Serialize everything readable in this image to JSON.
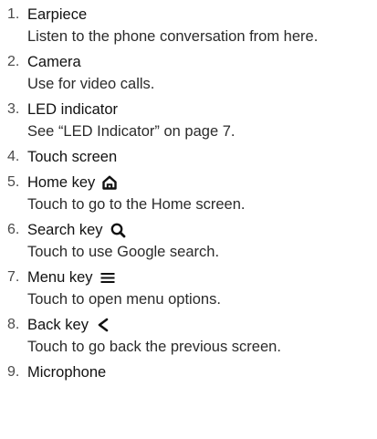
{
  "items": [
    {
      "num": "1.",
      "title": "Earpiece",
      "desc": "Listen to the phone conversation from here."
    },
    {
      "num": "2.",
      "title": "Camera",
      "desc": "Use for video calls."
    },
    {
      "num": "3.",
      "title": "LED indicator",
      "desc": "See “LED Indicator” on page 7."
    },
    {
      "num": "4.",
      "title": "Touch screen"
    },
    {
      "num": "5.",
      "title": "Home key",
      "icon": "home-icon",
      "desc": "Touch to go to the Home screen."
    },
    {
      "num": "6.",
      "title": "Search key",
      "icon": "search-icon",
      "desc": "Touch to use Google search."
    },
    {
      "num": "7.",
      "title": "Menu key",
      "icon": "menu-icon",
      "desc": "Touch to open menu options."
    },
    {
      "num": "8.",
      "title": "Back key",
      "icon": "back-icon",
      "desc": "Touch to go back the previous screen."
    },
    {
      "num": "9.",
      "title": "Microphone"
    }
  ]
}
